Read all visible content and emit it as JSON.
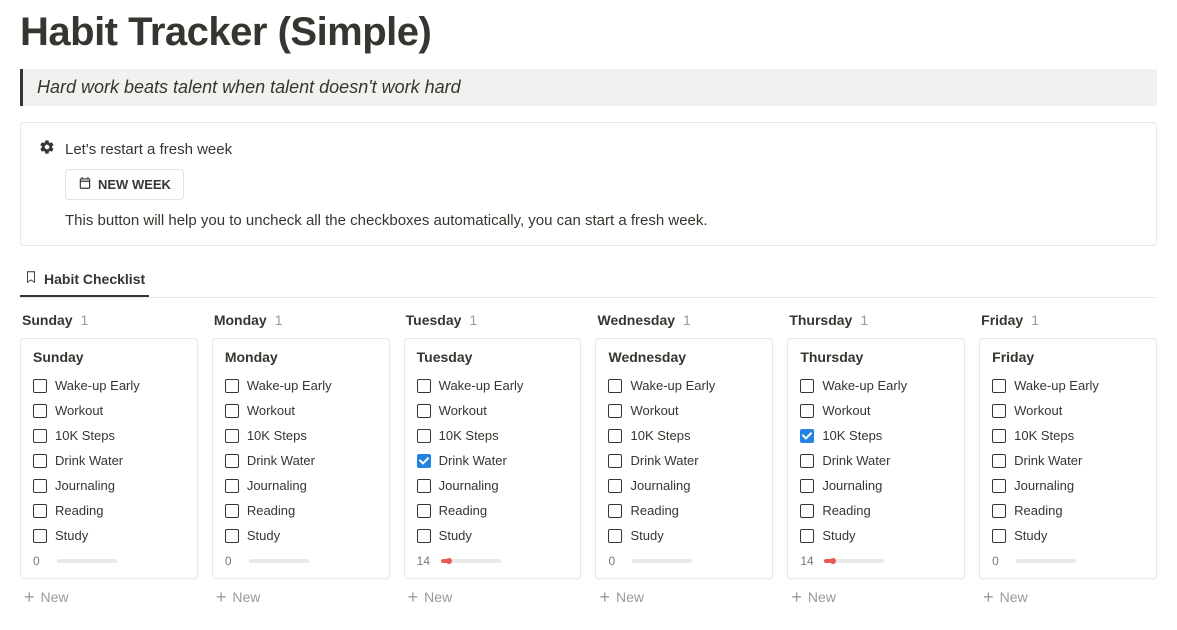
{
  "title": "Habit Tracker (Simple)",
  "quote": "Hard work beats talent when talent doesn't work hard",
  "callout": {
    "heading": "Let's restart a fresh week",
    "button": "NEW WEEK",
    "description": "This button will help you to uncheck all the checkboxes automatically, you can start a fresh week."
  },
  "tab_label": "Habit Checklist",
  "new_label": "New",
  "habits": [
    "Wake-up Early",
    "Workout",
    "10K Steps",
    "Drink Water",
    "Journaling",
    "Reading",
    "Study"
  ],
  "columns": [
    {
      "group": "Sunday",
      "count": 1,
      "card": "Sunday",
      "checked": [
        false,
        false,
        false,
        false,
        false,
        false,
        false
      ],
      "progress": 0
    },
    {
      "group": "Monday",
      "count": 1,
      "card": "Monday",
      "checked": [
        false,
        false,
        false,
        false,
        false,
        false,
        false
      ],
      "progress": 0
    },
    {
      "group": "Tuesday",
      "count": 1,
      "card": "Tuesday",
      "checked": [
        false,
        false,
        false,
        true,
        false,
        false,
        false
      ],
      "progress": 14
    },
    {
      "group": "Wednesday",
      "count": 1,
      "card": "Wednesday",
      "checked": [
        false,
        false,
        false,
        false,
        false,
        false,
        false
      ],
      "progress": 0
    },
    {
      "group": "Thursday",
      "count": 1,
      "card": "Thursday",
      "checked": [
        false,
        false,
        true,
        false,
        false,
        false,
        false
      ],
      "progress": 14
    },
    {
      "group": "Friday",
      "count": 1,
      "card": "Friday",
      "checked": [
        false,
        false,
        false,
        false,
        false,
        false,
        false
      ],
      "progress": 0
    }
  ]
}
